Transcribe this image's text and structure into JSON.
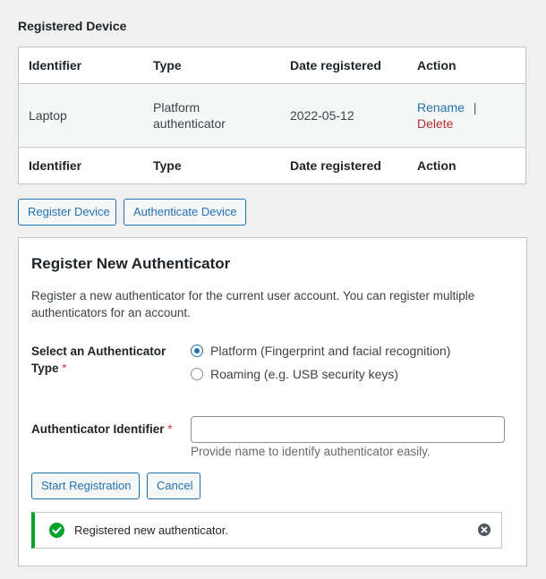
{
  "section_title": "Registered Device",
  "table": {
    "columns": [
      "Identifier",
      "Type",
      "Date registered",
      "Action"
    ],
    "rows": [
      {
        "identifier": "Laptop",
        "type": "Platform authenticator",
        "date_registered": "2022-05-12",
        "actions": {
          "rename": "Rename",
          "separator": "|",
          "delete": "Delete"
        }
      }
    ]
  },
  "buttons": {
    "register_device": "Register Device",
    "authenticate_device": "Authenticate Device"
  },
  "panel": {
    "title": "Register New Authenticator",
    "description": "Register a new authenticator for the current user account. You can register multiple authenticators for an account.",
    "type_field": {
      "label": "Select an Authenticator Type",
      "required_mark": "*",
      "options": [
        {
          "label": "Platform (Fingerprint and facial recognition)",
          "checked": true
        },
        {
          "label": "Roaming (e.g. USB security keys)",
          "checked": false
        }
      ]
    },
    "identifier_field": {
      "label": "Authenticator Identifier",
      "required_mark": "*",
      "value": "",
      "help": "Provide name to identify authenticator easily."
    },
    "start_button": "Start Registration",
    "cancel_button": "Cancel",
    "notice": {
      "text": "Registered new authenticator.",
      "status_color": "#00a32a"
    }
  }
}
